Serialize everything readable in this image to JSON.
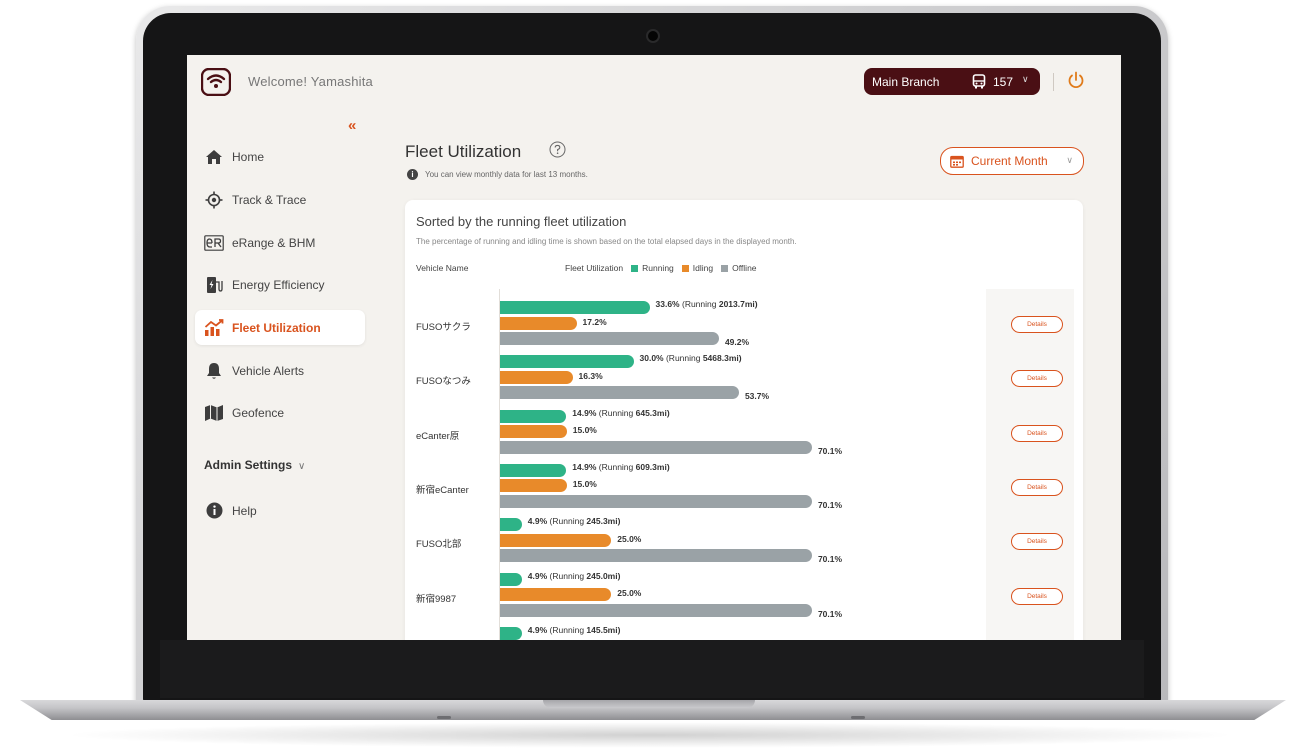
{
  "header": {
    "welcome": "Welcome! Yamashita",
    "branch": "Main Branch",
    "vehicle_count": "157"
  },
  "sidebar": {
    "items": [
      {
        "label": "Home",
        "icon": "home-icon"
      },
      {
        "label": "Track & Trace",
        "icon": "location-target-icon"
      },
      {
        "label": "eRange & BHM",
        "icon": "erange-icon"
      },
      {
        "label": "Energy Efficiency",
        "icon": "charging-station-icon"
      },
      {
        "label": "Fleet Utilization",
        "icon": "chart-trend-icon",
        "active": true
      },
      {
        "label": "Vehicle Alerts",
        "icon": "bell-icon"
      },
      {
        "label": "Geofence",
        "icon": "map-icon"
      }
    ],
    "admin_settings": "Admin Settings",
    "help": "Help"
  },
  "main": {
    "title": "Fleet Utilization",
    "info": "You can view monthly data for last 13 months.",
    "period": "Current Month"
  },
  "card": {
    "title": "Sorted by the running fleet utilization",
    "subtitle": "The percentage of running and idling time is shown based on the total elapsed days in the displayed month.",
    "col_vehicle": "Vehicle Name",
    "col_util": "Fleet Utilization",
    "legend": {
      "running": "Running",
      "idling": "Idling",
      "offline": "Offline"
    },
    "details_label": "Details"
  },
  "colors": {
    "running": "#2eb387",
    "idling": "#e88a2a",
    "offline": "#9aa2a6",
    "accent": "#d9531e",
    "brand_dark": "#4a0f14"
  },
  "chart_data": {
    "type": "bar",
    "orientation": "horizontal",
    "categories": [
      "FUSOサクラ",
      "FUSOなつみ",
      "eCanter原",
      "新宿eCanter",
      "FUSO北部",
      "新宿9987",
      ""
    ],
    "series": [
      {
        "name": "Running",
        "values": [
          33.6,
          30.0,
          14.9,
          14.9,
          4.9,
          4.9,
          4.9
        ]
      },
      {
        "name": "Idling",
        "values": [
          17.2,
          16.3,
          15.0,
          15.0,
          25.0,
          25.0,
          null
        ]
      },
      {
        "name": "Offline",
        "values": [
          49.2,
          53.7,
          70.1,
          70.1,
          70.1,
          70.1,
          null
        ]
      }
    ],
    "running_distance": [
      "2013.7mi",
      "5468.3mi",
      "645.3mi",
      "609.3mi",
      "245.3mi",
      "245.0mi",
      "145.5mi"
    ],
    "running_label_prefix": "(Running ",
    "value_unit": "%",
    "xlim": [
      0,
      100
    ]
  }
}
